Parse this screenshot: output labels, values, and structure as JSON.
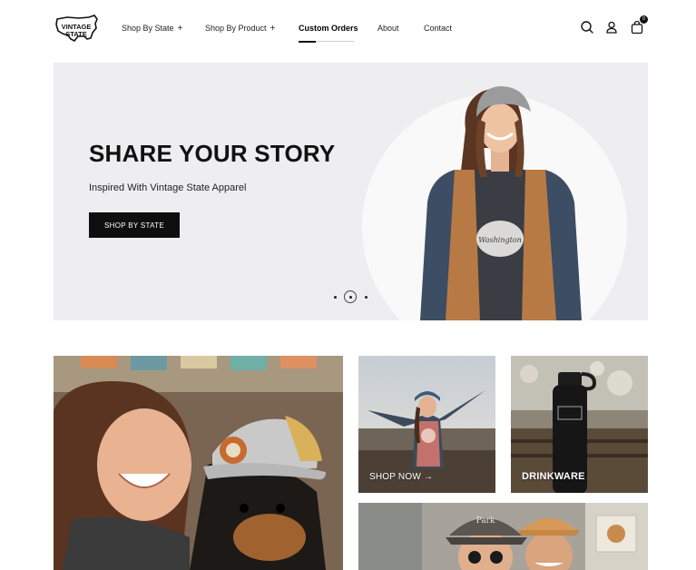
{
  "brand": {
    "logo_line1": "VINTAGE",
    "logo_line2": "STATE"
  },
  "nav": {
    "items": [
      {
        "label": "Shop By State",
        "suffix": "+"
      },
      {
        "label": "Shop By Product",
        "suffix": "+"
      },
      {
        "label": "Custom Orders",
        "suffix": ""
      },
      {
        "label": "About",
        "suffix": ""
      },
      {
        "label": "Contact",
        "suffix": ""
      }
    ]
  },
  "header_icons": {
    "search": "search-icon",
    "account": "user-icon",
    "cart": "bag-icon",
    "cart_count": "0"
  },
  "hero": {
    "title": "SHARE YOUR STORY",
    "subtitle": "Inspired With Vintage State Apparel",
    "button_label": "SHOP BY STATE",
    "slides_total": 3,
    "active_slide": 2,
    "shirt_print": "Washington"
  },
  "tiles": {
    "shop_now": {
      "label": "SHOP NOW",
      "arrow": "→"
    },
    "drinkware": {
      "label": "DRINKWARE"
    }
  },
  "colors": {
    "accent": "#111111",
    "hero_bg": "#eeeef0",
    "hero_circle": "#f9f9fa"
  }
}
